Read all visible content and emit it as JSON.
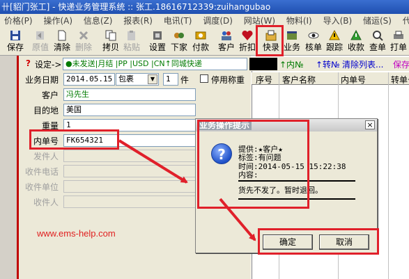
{
  "window": {
    "title": "卄[貂门张工] - 快递业务管理系统 :: 张工.18616712339:zuihangubao"
  },
  "menu": [
    "价格(P)",
    "操作(A)",
    "信息(Z)",
    "报表(R)",
    "电讯(T)",
    "调度(D)",
    "网站(W)",
    "物料(I)",
    "导入(B)",
    "储运(S)",
    "代理"
  ],
  "toolbar": {
    "items": [
      {
        "label": "保存",
        "icon": "save-icon",
        "disabled": false
      },
      {
        "label": "原值",
        "icon": "revert-icon",
        "disabled": true
      },
      {
        "label": "清除",
        "icon": "clear-icon",
        "disabled": false
      },
      {
        "label": "删除",
        "icon": "delete-icon",
        "disabled": true
      },
      {
        "label": "拷贝",
        "icon": "copy-icon",
        "disabled": false
      },
      {
        "label": "粘贴",
        "icon": "paste-icon",
        "disabled": true
      },
      {
        "label": "设置",
        "icon": "settings-icon",
        "disabled": false
      },
      {
        "label": "下家",
        "icon": "next-party-icon",
        "disabled": false
      },
      {
        "label": "付款",
        "icon": "payment-icon",
        "disabled": false
      },
      {
        "label": "客户",
        "icon": "customer-icon",
        "disabled": false
      },
      {
        "label": "折扣",
        "icon": "discount-icon",
        "disabled": false
      },
      {
        "label": "快录",
        "icon": "quick-entry-icon",
        "disabled": false
      },
      {
        "label": "业务",
        "icon": "business-icon",
        "disabled": false
      },
      {
        "label": "核单",
        "icon": "verify-icon",
        "disabled": false
      },
      {
        "label": "跟踪",
        "icon": "track-icon",
        "disabled": false
      },
      {
        "label": "收款",
        "icon": "receive-icon",
        "disabled": false
      },
      {
        "label": "查单",
        "icon": "query-icon",
        "disabled": false
      },
      {
        "label": "打单",
        "icon": "print-icon",
        "disabled": false
      }
    ]
  },
  "topstrip": {
    "settings_label": "设定->",
    "status_unsent": "●未发送",
    "status_options": "|月结 |PP |USD |CN↑同城快递",
    "inner_no": "↑内№",
    "transfer_no": "↑转№",
    "clear_list": "清除列表...",
    "save": "保存"
  },
  "form": {
    "business_date_label": "业务日期",
    "business_date": "2014.05.15",
    "package_type": "包裹",
    "pieces": "1",
    "pieces_unit": "件",
    "disable_scale_label": "停用称重",
    "customer_label": "客户",
    "customer": "冯先生",
    "destination_label": "目的地",
    "destination": "美国",
    "weight_label": "重量",
    "weight": "1",
    "inner_no_label": "内单号",
    "inner_no": "FK654321",
    "sender_label": "发件人",
    "receiver_phone_label": "收件电话",
    "receiver_company_label": "收件单位",
    "receiver_label": "收件人"
  },
  "grid": {
    "columns": [
      "序号",
      "客户名称",
      "内单号",
      "转单号"
    ]
  },
  "dialog": {
    "title": "业务操作提示",
    "line1": "提供:★客户★",
    "line2": "标签:有问题",
    "line3": "时间:2014-05-15 15:22:38",
    "line4": "内容:",
    "line5": "货先不发了。暂时退回。",
    "ok": "确定",
    "cancel": "取消",
    "close": "×"
  },
  "watermark": "www.ems-help.com",
  "colors": {
    "highlight": "#e0202a",
    "titlebar": "#1f4fb0",
    "status_green": "#007a00",
    "link_blue": "#0000cc"
  }
}
